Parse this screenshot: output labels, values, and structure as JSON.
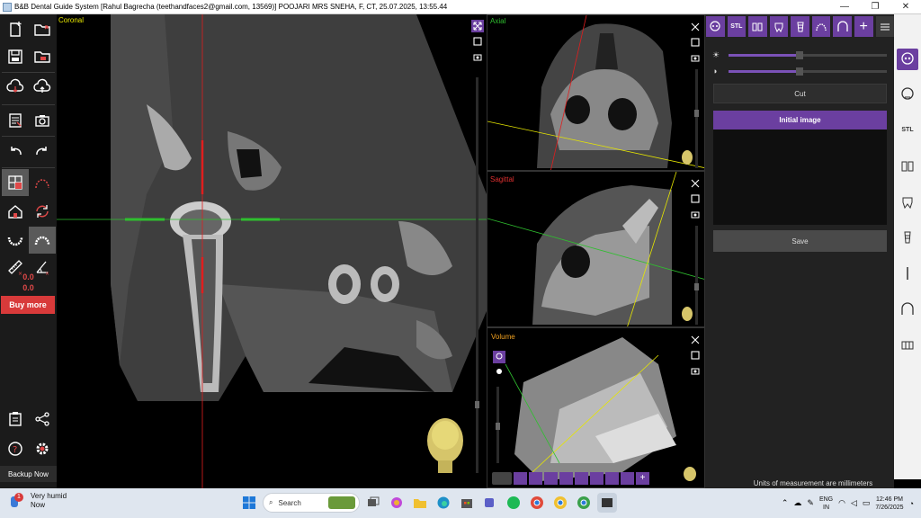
{
  "window": {
    "title": "B&B Dental Guide System [Rahul Bagrecha (teethandfaces2@gmail.com, 13569)] POOJARI MRS SNEHA, F, CT, 25.07.2025, 13:55.44",
    "minimize": "—",
    "maximize": "❐",
    "close": "✕"
  },
  "left_toolbar": {
    "value_1": "0.0",
    "value_2": "0.0",
    "buy_more": "Buy more",
    "backup_now": "Backup Now"
  },
  "views": {
    "coronal": {
      "label": "Coronal",
      "color": "#e6e600"
    },
    "axial": {
      "label": "Axial",
      "color": "#2fbf2f"
    },
    "sagittal": {
      "label": "Sagittal",
      "color": "#e03030"
    },
    "volume": {
      "label": "Volume",
      "color": "#f0a020"
    }
  },
  "right_panel": {
    "toolbar": [
      "skull-icon",
      "stl-icon",
      "teeth-pair-icon",
      "tooth-icon",
      "implant-icon",
      "arch-icon",
      "jaw-icon",
      "add-icon",
      "menu-icon"
    ],
    "stl_label": "STL",
    "brightness_value": 0.45,
    "contrast_value": 0.45,
    "cut_button": "Cut",
    "list_header": "Initial image",
    "save_button": "Save",
    "units_note": "Units of measurement are millimeters"
  },
  "right_strip": [
    "skull-icon",
    "face-scan-icon",
    "stl-icon",
    "teeth-pair-icon",
    "tooth-icon",
    "implant-icon",
    "pin-icon",
    "jaw-icon",
    "bridge-icon"
  ],
  "taskbar": {
    "weather_badge": "1",
    "weather_line1": "Very humid",
    "weather_line2": "Now",
    "search_placeholder": "Search",
    "lang_line1": "ENG",
    "lang_line2": "IN",
    "time": "12:46 PM",
    "date": "7/26/2025"
  },
  "colors": {
    "accent": "#6b3fa0",
    "buy_more": "#d83a3a",
    "crosshair_red": "#e01e1e",
    "crosshair_green": "#2fbf2f"
  }
}
